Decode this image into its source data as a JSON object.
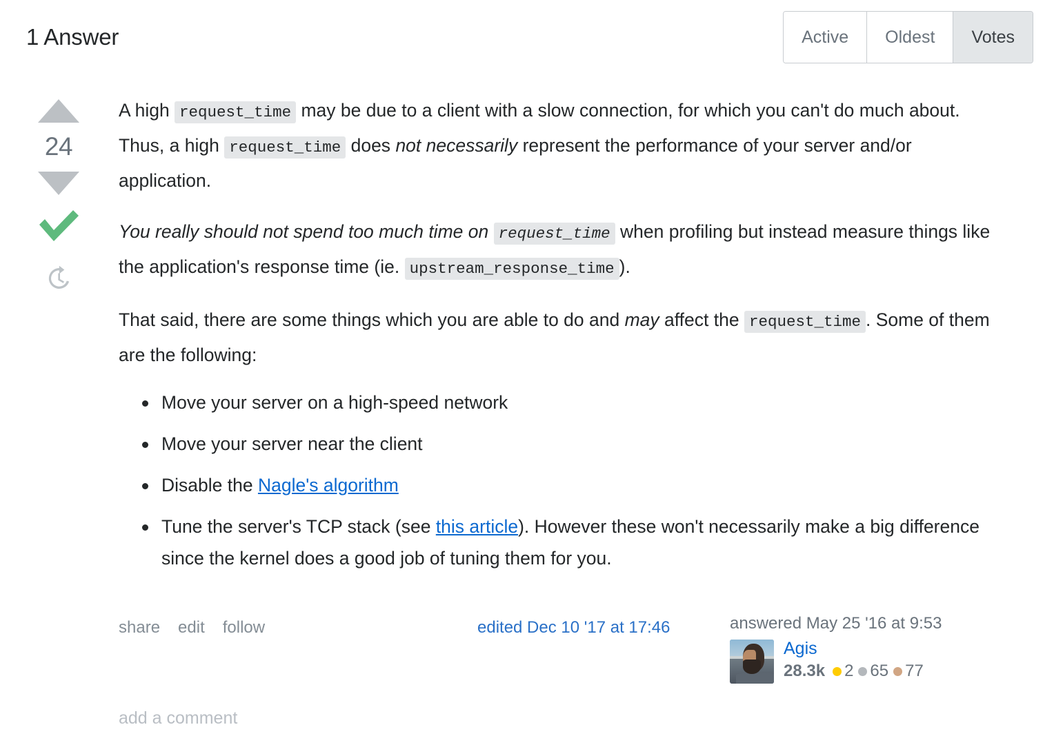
{
  "header": {
    "answers_title": "1 Answer",
    "sort_tabs": [
      {
        "label": "Active",
        "selected": false
      },
      {
        "label": "Oldest",
        "selected": false
      },
      {
        "label": "Votes",
        "selected": true
      }
    ]
  },
  "answer": {
    "vote_count": "24",
    "accepted": true,
    "icons": {
      "upvote": "triangle-up-icon",
      "downvote": "triangle-down-icon",
      "accepted": "checkmark-icon",
      "history": "history-clock-icon"
    },
    "paragraph1": {
      "t1": "A high ",
      "code1": "request_time",
      "t2": " may be due to a client with a slow connection, for which you can't do much about. Thus, a high ",
      "code2": "request_time",
      "t3": " does ",
      "em1": "not necessarily",
      "t4": " represent the performance of your server and/or application."
    },
    "paragraph2": {
      "em1": "You really should not spend too much time on ",
      "code1": "request_time",
      "t2": " when profiling but instead measure things like the application's response time (ie. ",
      "code2": "upstream_response_time",
      "t3": ")."
    },
    "paragraph3": {
      "t1": "That said, there are some things which you are able to do and ",
      "em1": "may",
      "t2": " affect the ",
      "code1": "request_time",
      "t3": ". Some of them are the following:"
    },
    "bullets": [
      {
        "t1": "Move your server on a high-speed network",
        "link": "",
        "t2": ""
      },
      {
        "t1": "Move your server near the client",
        "link": "",
        "t2": ""
      },
      {
        "t1": "Disable the ",
        "link": "Nagle's algorithm",
        "t2": ""
      },
      {
        "t1": "Tune the server's TCP stack (see ",
        "link": "this article",
        "t2": "). However these won't necessarily make a big difference since the kernel does a good job of tuning them for you."
      }
    ],
    "footer": {
      "post_menu": [
        "share",
        "edit",
        "follow"
      ],
      "edited_stamp": "edited Dec 10 '17 at 17:46",
      "answered_stamp": "answered May 25 '16 at 9:53",
      "user": {
        "name": "Agis",
        "reputation": "28.3k",
        "badges": {
          "gold": "2",
          "silver": "65",
          "bronze": "77"
        }
      }
    },
    "add_comment": "add a comment"
  },
  "colors": {
    "link": "#0c69d0",
    "accepted_green": "#5eba7d",
    "vote_arrow_gray": "#bcc0c4",
    "code_bg": "#e4e6e8",
    "gold": "#ffcc01",
    "silver": "#b4b8bc",
    "bronze": "#d1a684",
    "selected_tab_bg": "#e3e6e8"
  }
}
